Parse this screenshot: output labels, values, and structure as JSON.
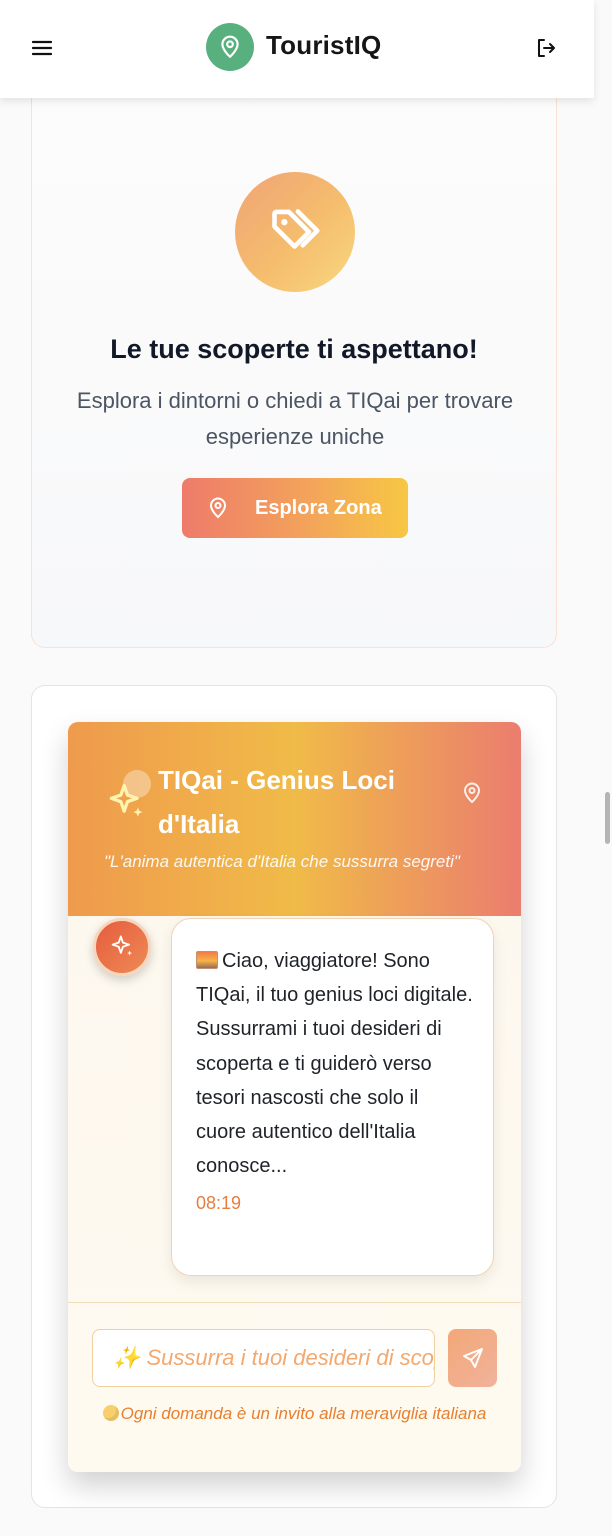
{
  "header": {
    "app_title": "TouristIQ",
    "menu_icon": "hamburger-menu-icon",
    "logo_icon": "map-pin-icon",
    "logout_icon": "logout-icon"
  },
  "discoveries": {
    "icon": "tags-icon",
    "title": "Le tue scoperte ti aspettano!",
    "description": "Esplora i dintorni o chiedi a TIQai per trovare esperienze uniche",
    "button_label": "Esplora Zona",
    "button_icon": "map-pin-icon"
  },
  "chat": {
    "title": "TIQai - Genius Loci d'Italia",
    "tagline": "\"L'anima autentica d'Italia che sussurra segreti\"",
    "messages": [
      {
        "sender": "bot",
        "emoji": "sunset-emoji",
        "text": "Ciao, viaggiatore! Sono TIQai, il tuo genius loci digitale. Sussurrami i tuoi desideri di scoperta e ti guiderò verso tesori nascosti che solo il cuore autentico dell'Italia conosce...",
        "time": "08:19"
      }
    ],
    "input_placeholder": "✨ Sussurra i tuoi desideri di scoperta...",
    "send_icon": "send-icon",
    "hint": "Ogni domanda è un invito alla meraviglia italiana"
  },
  "colors": {
    "logo_green": "#58b07f",
    "accent_orange": "#e67f31",
    "header_gradient": [
      "#ef9a4d",
      "#f0bb48",
      "#eb7d6f"
    ],
    "button_gradient": [
      "#ee7b6a",
      "#f3a35b",
      "#f7c744"
    ]
  }
}
